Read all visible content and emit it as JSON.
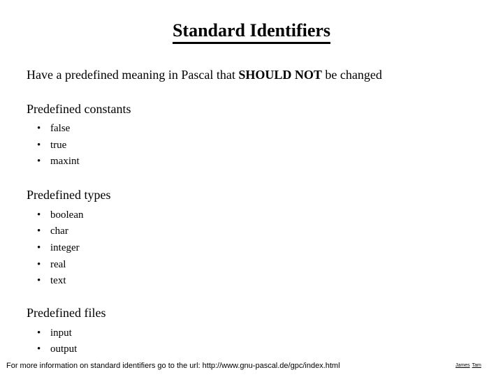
{
  "slide": {
    "title": "Standard Identifiers",
    "lead": {
      "before": "Have a predefined meaning in Pascal that ",
      "emphasis": "SHOULD NOT",
      "after": " be changed"
    },
    "sections": [
      {
        "heading": "Predefined constants",
        "items": [
          "false",
          "true",
          "maxint"
        ]
      },
      {
        "heading": "Predefined types",
        "items": [
          "boolean",
          "char",
          "integer",
          "real",
          "text"
        ]
      },
      {
        "heading": "Predefined files",
        "items": [
          "input",
          "output"
        ]
      }
    ],
    "bullet_glyph": "•",
    "footer": {
      "note": "For more information on standard identifiers go to the url: http://www.gnu-pascal.de/gpc/index.html",
      "credit_first": "James",
      "credit_last": "Tam"
    },
    "colors": {
      "background": "#ffffff",
      "text": "#000000"
    }
  }
}
